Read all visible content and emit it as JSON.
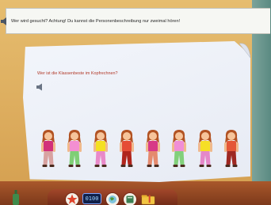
{
  "instruction": {
    "text": "Wer wird gesucht? Achtung! Du kannst die Personenbeschreibung nur zweimal hören!",
    "speaker_icon": "speaker-icon"
  },
  "question": {
    "text": "Wer ist die Klassenbeste im Kopfrechnen?",
    "speaker_icon": "speaker-icon"
  },
  "figures": [
    {
      "id": "figure-1",
      "shirt": "#d2307a",
      "pants": "#d8a2a0"
    },
    {
      "id": "figure-2",
      "shirt": "#f38fd2",
      "pants": "#7fcf76"
    },
    {
      "id": "figure-3",
      "shirt": "#f4e022",
      "pants": "#e98ac9"
    },
    {
      "id": "figure-4",
      "shirt": "#e54d35",
      "pants": "#b0251c"
    },
    {
      "id": "figure-5",
      "shirt": "#d73987",
      "pants": "#e58a6e"
    },
    {
      "id": "figure-6",
      "shirt": "#f08ed6",
      "pants": "#82d07b"
    },
    {
      "id": "figure-7",
      "shirt": "#f6df26",
      "pants": "#e588c9"
    },
    {
      "id": "figure-8",
      "shirt": "#e45637",
      "pants": "#9e2822"
    }
  ],
  "dock": {
    "clock_display": "0100",
    "icons": [
      "star-icon",
      "clock-icon",
      "globe-icon",
      "book-icon",
      "folder-icon"
    ]
  },
  "colors": {
    "question_text": "#b23a2a",
    "paper": "#eef1f8",
    "wall": "#dcab5c"
  }
}
